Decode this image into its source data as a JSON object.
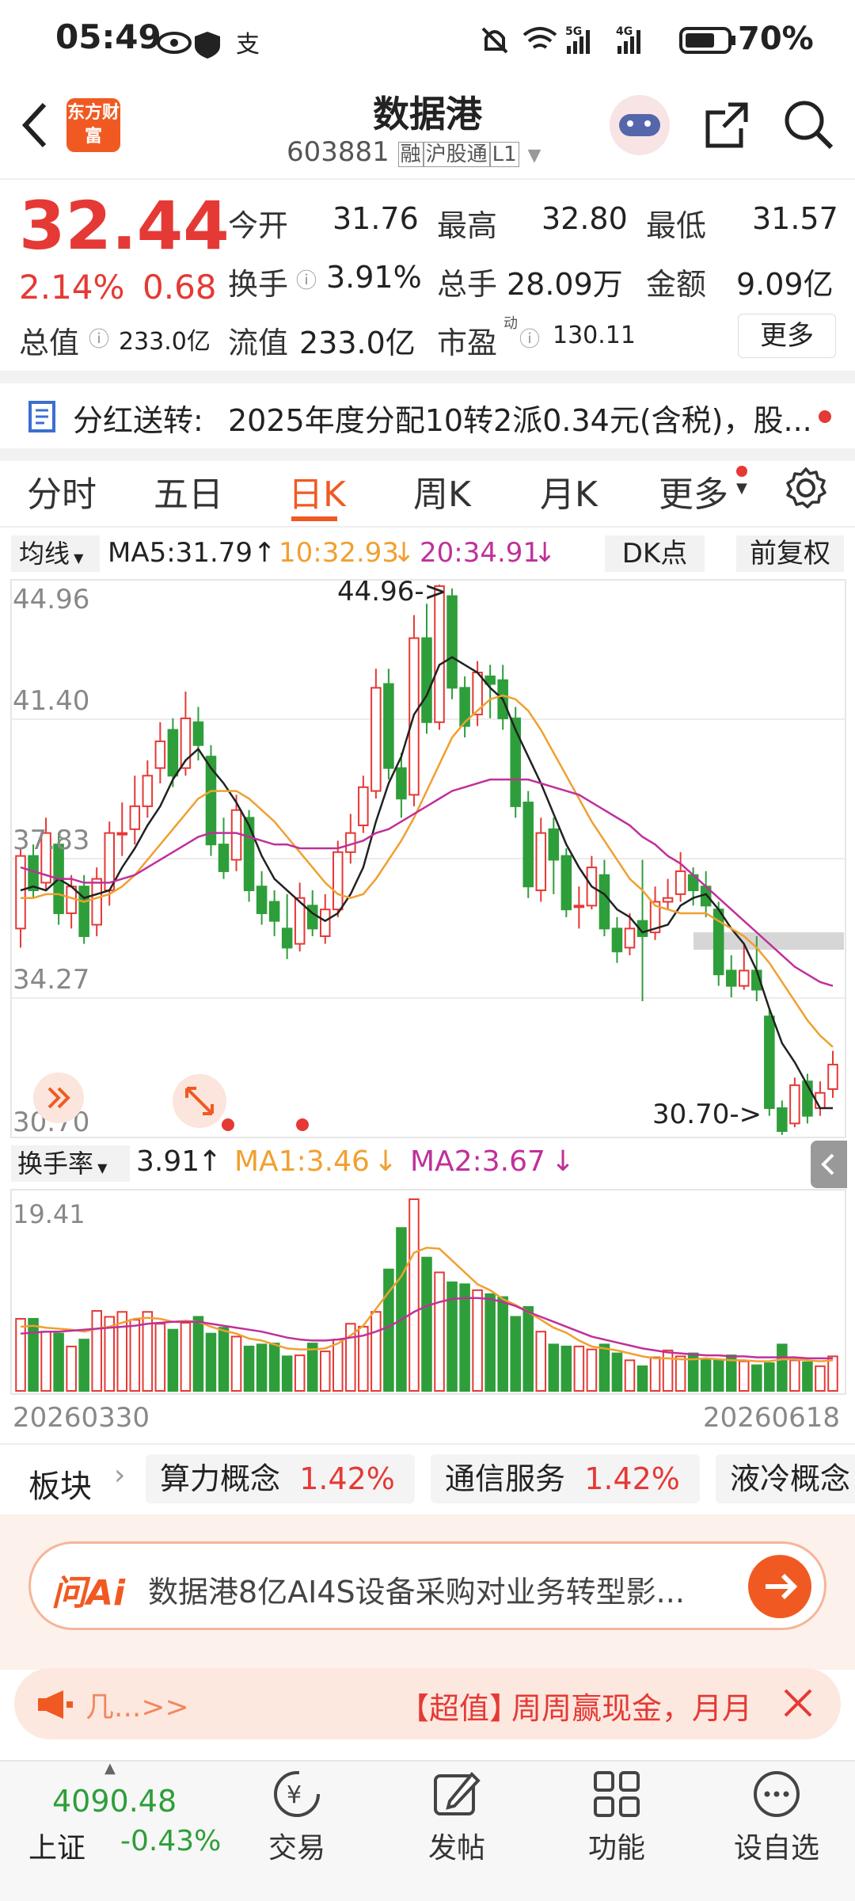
{
  "status_bar": {
    "time": "05:49",
    "battery": "70%"
  },
  "header": {
    "title": "数据港",
    "code": "603881",
    "tags": [
      "融",
      "沪股通",
      "L1"
    ],
    "logo": "东方财富"
  },
  "quote": {
    "price": "32.44",
    "change_pct": "2.14%",
    "change": "0.68",
    "stats": [
      {
        "label": "今开",
        "value": "31.76"
      },
      {
        "label": "最高",
        "value": "32.80"
      },
      {
        "label": "最低",
        "value": "31.57"
      },
      {
        "label": "换手",
        "value": "3.91%"
      },
      {
        "label": "总手",
        "value": "28.09万"
      },
      {
        "label": "金额",
        "value": "9.09亿"
      },
      {
        "label": "总值",
        "value": "233.0亿"
      },
      {
        "label": "流值",
        "value": "233.0亿"
      },
      {
        "label": "市盈",
        "sup": "动",
        "value": "130.11"
      }
    ],
    "more": "更多"
  },
  "dividend": {
    "label": "分红送转:",
    "text": "2025年度分配10转2派0.34元(含税)，股..."
  },
  "tabs": [
    "分时",
    "五日",
    "日K",
    "周K",
    "月K",
    "更多"
  ],
  "active_tab": "日K",
  "ma_bar": {
    "selector": "均线",
    "ma5": "MA5:31.79",
    "ma10": "10:32.93",
    "ma20": "20:34.91",
    "dk": "DK点",
    "fq": "前复权"
  },
  "chart_labels": {
    "y_ticks": [
      "44.96",
      "41.40",
      "37.83",
      "34.27",
      "30.70"
    ],
    "high_note": "44.96->",
    "low_note": "30.70->"
  },
  "turnover_bar": {
    "selector": "换手率",
    "value": "3.91",
    "ma1": "MA1:3.46",
    "ma2": "MA2:3.67",
    "y_max": "19.41"
  },
  "x_axis": {
    "start": "20260330",
    "end": "20260618"
  },
  "chart_data": {
    "type": "candlestick",
    "ylim": [
      30.7,
      44.96
    ],
    "candles": [
      [
        36.0,
        37.9,
        38.1,
        35.5
      ],
      [
        37.9,
        37.0,
        38.2,
        36.8
      ],
      [
        37.2,
        38.5,
        38.9,
        37.0
      ],
      [
        38.2,
        36.4,
        38.5,
        36.1
      ],
      [
        36.4,
        37.1,
        37.4,
        36.0
      ],
      [
        37.1,
        35.8,
        37.4,
        35.6
      ],
      [
        36.1,
        37.3,
        37.6,
        35.8
      ],
      [
        37.0,
        38.5,
        38.8,
        36.6
      ],
      [
        38.5,
        38.5,
        39.3,
        37.9
      ],
      [
        38.6,
        39.2,
        40.0,
        38.2
      ],
      [
        39.2,
        40.0,
        40.4,
        38.9
      ],
      [
        40.2,
        40.9,
        41.4,
        39.8
      ],
      [
        41.2,
        40.0,
        41.5,
        39.7
      ],
      [
        40.2,
        41.5,
        42.2,
        40.0
      ],
      [
        41.4,
        40.8,
        41.8,
        40.4
      ],
      [
        40.5,
        38.2,
        40.8,
        37.9
      ],
      [
        38.2,
        37.5,
        38.9,
        37.3
      ],
      [
        37.8,
        39.1,
        39.5,
        37.5
      ],
      [
        38.9,
        37.0,
        39.1,
        36.7
      ],
      [
        37.1,
        36.4,
        37.5,
        36.1
      ],
      [
        36.7,
        36.2,
        37.0,
        35.8
      ],
      [
        36.0,
        35.5,
        36.9,
        35.2
      ],
      [
        35.6,
        36.8,
        37.2,
        35.4
      ],
      [
        36.6,
        36.0,
        37.0,
        35.8
      ],
      [
        35.8,
        36.5,
        36.9,
        35.6
      ],
      [
        36.5,
        38.0,
        38.3,
        36.3
      ],
      [
        38.0,
        38.5,
        39.0,
        37.7
      ],
      [
        38.7,
        39.7,
        40.0,
        38.5
      ],
      [
        39.6,
        42.3,
        42.8,
        39.4
      ],
      [
        42.4,
        40.2,
        42.8,
        39.9
      ],
      [
        40.2,
        39.4,
        40.6,
        38.9
      ],
      [
        39.5,
        43.6,
        44.2,
        39.2
      ],
      [
        43.6,
        41.4,
        44.5,
        41.1
      ],
      [
        41.4,
        44.96,
        45.0,
        41.2
      ],
      [
        44.7,
        42.3,
        44.9,
        42.0
      ],
      [
        42.3,
        41.3,
        42.6,
        41.0
      ],
      [
        41.6,
        42.7,
        43.0,
        41.3
      ],
      [
        42.6,
        42.4,
        42.9,
        41.5
      ],
      [
        42.5,
        41.5,
        42.9,
        41.2
      ],
      [
        41.5,
        39.2,
        41.8,
        38.9
      ],
      [
        39.3,
        37.1,
        39.6,
        36.8
      ],
      [
        37.0,
        38.5,
        38.9,
        36.7
      ],
      [
        38.6,
        37.8,
        38.9,
        36.9
      ],
      [
        37.9,
        36.5,
        38.1,
        36.3
      ],
      [
        36.6,
        36.6,
        37.1,
        36.0
      ],
      [
        36.6,
        37.6,
        37.9,
        36.5
      ],
      [
        37.4,
        36.0,
        37.8,
        35.8
      ],
      [
        36.0,
        35.4,
        36.3,
        35.1
      ],
      [
        35.5,
        36.0,
        36.4,
        35.3
      ],
      [
        36.2,
        35.8,
        37.8,
        34.1
      ],
      [
        35.9,
        36.7,
        37.1,
        35.7
      ],
      [
        36.7,
        36.8,
        37.3,
        36.5
      ],
      [
        36.9,
        37.5,
        38.0,
        36.7
      ],
      [
        37.4,
        37.0,
        37.6,
        36.6
      ],
      [
        37.1,
        36.6,
        37.5,
        36.3
      ],
      [
        36.5,
        34.8,
        36.7,
        34.5
      ],
      [
        34.9,
        34.5,
        35.3,
        34.2
      ],
      [
        34.5,
        34.9,
        35.6,
        34.4
      ],
      [
        34.9,
        34.4,
        35.8,
        34.1
      ],
      [
        33.7,
        31.3,
        33.9,
        31.1
      ],
      [
        31.3,
        30.7,
        31.5,
        30.6
      ],
      [
        30.9,
        31.9,
        32.1,
        30.8
      ],
      [
        32.0,
        31.1,
        32.2,
        30.9
      ],
      [
        31.3,
        31.7,
        32.0,
        31.1
      ],
      [
        31.8,
        32.44,
        32.8,
        31.57
      ]
    ],
    "ma5": [
      37.0,
      37.1,
      37.0,
      37.3,
      37.1,
      36.8,
      36.9,
      37.0,
      37.6,
      38.1,
      38.7,
      39.2,
      39.9,
      40.4,
      40.7,
      40.2,
      39.8,
      39.3,
      38.7,
      37.9,
      37.3,
      37.0,
      36.7,
      36.4,
      36.2,
      36.4,
      36.9,
      37.6,
      38.8,
      39.8,
      40.5,
      41.6,
      42.1,
      42.9,
      43.1,
      42.9,
      42.7,
      42.3,
      42.0,
      41.2,
      40.5,
      39.8,
      39.0,
      38.2,
      37.6,
      37.1,
      36.9,
      36.5,
      36.3,
      35.9,
      36.0,
      36.1,
      36.6,
      36.8,
      36.9,
      36.5,
      36.0,
      35.6,
      34.9,
      33.9,
      33.0,
      32.5,
      31.9,
      31.3,
      31.3
    ],
    "ma10": [
      36.8,
      36.8,
      36.9,
      36.9,
      36.8,
      36.7,
      36.8,
      36.9,
      37.1,
      37.4,
      37.8,
      38.2,
      38.6,
      39.0,
      39.4,
      39.6,
      39.6,
      39.6,
      39.4,
      39.1,
      38.8,
      38.4,
      38.0,
      37.6,
      37.2,
      36.9,
      36.8,
      36.9,
      37.3,
      37.8,
      38.3,
      38.9,
      39.6,
      40.3,
      41.0,
      41.4,
      41.7,
      42.0,
      42.1,
      42.0,
      41.7,
      41.2,
      40.6,
      40.0,
      39.4,
      38.8,
      38.3,
      37.8,
      37.3,
      37.0,
      36.6,
      36.5,
      36.4,
      36.4,
      36.4,
      36.2,
      36.0,
      35.8,
      35.5,
      35.1,
      34.6,
      34.1,
      33.6,
      33.2,
      32.9
    ],
    "ma20": [
      37.6,
      37.5,
      37.4,
      37.3,
      37.3,
      37.2,
      37.2,
      37.2,
      37.3,
      37.4,
      37.6,
      37.8,
      38.0,
      38.2,
      38.4,
      38.5,
      38.5,
      38.5,
      38.4,
      38.3,
      38.2,
      38.2,
      38.1,
      38.1,
      38.1,
      38.1,
      38.2,
      38.3,
      38.5,
      38.6,
      38.8,
      39.0,
      39.2,
      39.4,
      39.6,
      39.7,
      39.8,
      39.9,
      39.9,
      39.9,
      39.9,
      39.8,
      39.7,
      39.6,
      39.5,
      39.3,
      39.1,
      38.9,
      38.7,
      38.4,
      38.2,
      37.9,
      37.7,
      37.4,
      37.1,
      36.8,
      36.5,
      36.2,
      35.9,
      35.6,
      35.3,
      35.0,
      34.8,
      34.6,
      34.5
    ],
    "turnover": [
      7.3,
      7.3,
      6.0,
      5.8,
      4.5,
      5.2,
      8.1,
      7.5,
      8.0,
      7.2,
      8.0,
      6.8,
      6.2,
      6.9,
      7.5,
      5.8,
      6.4,
      5.5,
      4.5,
      4.7,
      4.8,
      3.5,
      3.6,
      4.8,
      4.0,
      5.2,
      6.8,
      6.5,
      8.0,
      12.3,
      16.5,
      19.41,
      13.5,
      12.0,
      11.0,
      10.8,
      10.2,
      9.8,
      9.5,
      7.5,
      8.5,
      6.0,
      4.7,
      4.5,
      4.5,
      4.2,
      4.7,
      3.8,
      3.1,
      2.5,
      3.4,
      4.1,
      3.5,
      3.8,
      3.2,
      3.1,
      3.6,
      3.0,
      2.6,
      2.8,
      4.7,
      3.1,
      2.9,
      2.5,
      3.5
    ],
    "ma1": [
      6.5,
      6.6,
      6.4,
      6.3,
      6.2,
      6.0,
      6.3,
      6.5,
      6.9,
      7.3,
      7.4,
      7.3,
      7.0,
      7.1,
      7.0,
      6.5,
      6.1,
      5.8,
      5.3,
      5.1,
      4.7,
      4.3,
      4.2,
      4.2,
      4.3,
      4.8,
      5.6,
      6.6,
      8.3,
      10.0,
      11.6,
      14.0,
      14.5,
      14.4,
      13.2,
      12.0,
      10.8,
      10.2,
      9.3,
      8.7,
      8.0,
      7.2,
      6.4,
      5.9,
      5.1,
      4.5,
      4.3,
      4.1,
      3.8,
      3.5,
      3.3,
      3.3,
      3.2,
      3.2,
      3.3,
      3.2,
      3.1,
      3.1,
      3.0,
      3.0,
      3.2,
      3.2,
      3.1,
      3.0,
      3.1
    ],
    "ma2": [
      5.8,
      5.9,
      6.0,
      6.0,
      6.1,
      6.2,
      6.3,
      6.4,
      6.5,
      6.6,
      6.8,
      6.9,
      7.0,
      7.0,
      7.0,
      6.8,
      6.6,
      6.4,
      6.2,
      6.0,
      5.7,
      5.4,
      5.2,
      5.1,
      5.1,
      5.2,
      5.4,
      5.6,
      6.0,
      6.5,
      7.2,
      8.0,
      8.6,
      9.0,
      9.3,
      9.4,
      9.4,
      9.3,
      9.0,
      8.6,
      8.0,
      7.5,
      7.0,
      6.5,
      6.0,
      5.5,
      5.2,
      4.9,
      4.6,
      4.3,
      4.1,
      3.9,
      3.8,
      3.7,
      3.6,
      3.6,
      3.5,
      3.5,
      3.4,
      3.4,
      3.4,
      3.4,
      3.3,
      3.3,
      3.3
    ]
  },
  "sectors": {
    "label": "板块",
    "items": [
      {
        "name": "算力概念",
        "pct": "1.42%"
      },
      {
        "name": "通信服务",
        "pct": "1.42%"
      },
      {
        "name": "液冷概念",
        "pct": ""
      }
    ]
  },
  "ai_box": {
    "logo": "问Ai",
    "text": "数据港8亿AI4S设备采购对业务转型影..."
  },
  "ad_bar": {
    "left": "几...>>",
    "tag": "【超值】",
    "text": "周周赢现金，月月"
  },
  "bottom_nav": {
    "index_value": "4090.48",
    "index_name": "上证",
    "index_change": "-0.43%",
    "items": [
      "交易",
      "发帖",
      "功能",
      "设自选"
    ]
  },
  "colors": {
    "up": "#e53935",
    "down": "#2e9e3a",
    "ma5": "#222222",
    "ma10": "#f0a030",
    "ma20": "#c0309a",
    "accent": "#f05a22"
  }
}
